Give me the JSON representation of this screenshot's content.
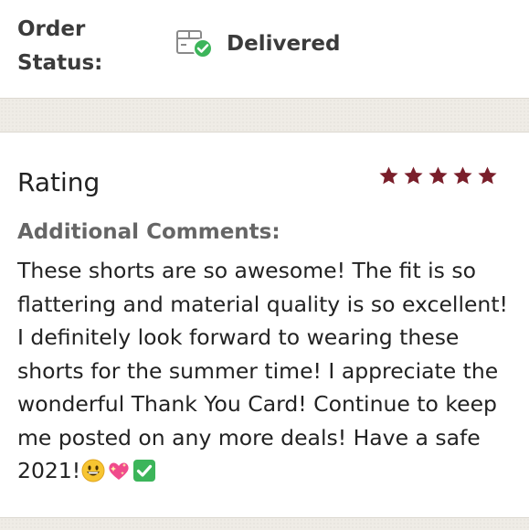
{
  "order_status": {
    "label": "Order\nStatus:",
    "value": "Delivered",
    "icon": "package-delivered-icon",
    "check_color": "#3cb55a"
  },
  "rating": {
    "label": "Rating",
    "stars": 5,
    "max_stars": 5,
    "star_color": "#7a1f2b"
  },
  "comments": {
    "label": "Additional Comments:",
    "text": "These shorts are so awesome! The fit is so flattering and material quality is so excellent! I definitely look forward to wearing these shorts for the summer time! I appreciate the wonderful Thank You Card! Continue to keep me posted on any more deals! Have a safe 2021!",
    "emojis": [
      "grinning-face-icon",
      "sparkling-heart-icon",
      "check-mark-button-icon"
    ]
  }
}
